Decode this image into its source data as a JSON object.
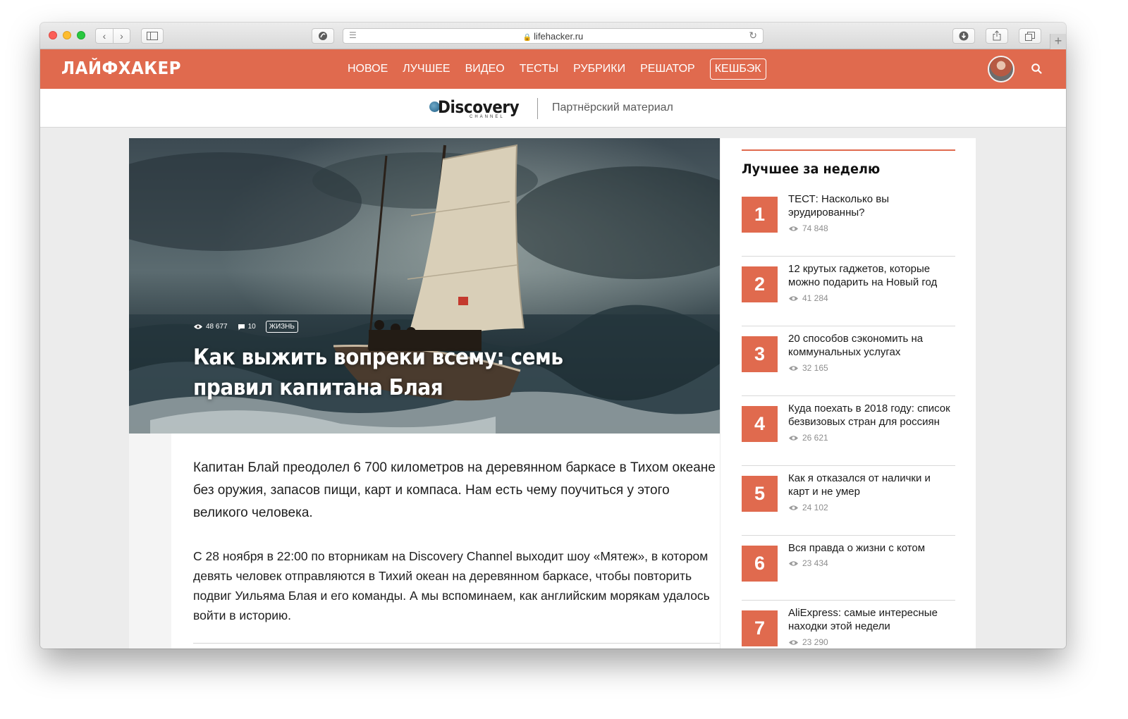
{
  "browser": {
    "url": "lifehacker.ru"
  },
  "site": {
    "logo": "ЛАЙФХАКЕР",
    "nav": [
      "НОВОЕ",
      "ЛУЧШЕЕ",
      "ВИДЕО",
      "ТЕСТЫ",
      "РУБРИКИ",
      "РЕШАТОР"
    ],
    "cashback": "КЕШБЭК",
    "accent_color": "#e06a4e"
  },
  "partner": {
    "brand": "Discovery",
    "brand_sub": "CHANNEL",
    "label": "Партнёрский материал"
  },
  "article": {
    "views": "48 677",
    "comments": "10",
    "tag": "ЖИЗНЬ",
    "title": "Как выжить вопреки всему: семь правил капитана Блая",
    "lead": "Капитан Блай преодолел 6 700 километров на деревянном баркасе в Тихом океане без оружия, запасов пищи, карт и компаса. Нам есть чему поучиться у этого великого человека.",
    "paragraph": "С 28 ноября в 22:00 по вторникам на Discovery Channel выходит шоу «Мятеж», в котором девять человек отправляются в Тихий океан на деревянном баркасе, чтобы повторить подвиг Уильяма Блая и его команды. А мы вспоминаем, как английским морякам удалось войти в историю."
  },
  "sidebar": {
    "title": "Лучшее за неделю",
    "items": [
      {
        "num": "1",
        "title": "ТЕСТ: Насколько вы эрудированны?",
        "views": "74 848"
      },
      {
        "num": "2",
        "title": "12 крутых гаджетов, которые можно подарить на Новый год",
        "views": "41 284"
      },
      {
        "num": "3",
        "title": "20 способов сэкономить на коммунальных услугах",
        "views": "32 165"
      },
      {
        "num": "4",
        "title": "Куда поехать в 2018 году: список безвизовых стран для россиян",
        "views": "26 621"
      },
      {
        "num": "5",
        "title": "Как я отказался от налички и карт и не умер",
        "views": "24 102"
      },
      {
        "num": "6",
        "title": "Вся правда о жизни с котом",
        "views": "23 434"
      },
      {
        "num": "7",
        "title": "AliExpress: самые интересные находки этой недели",
        "views": "23 290"
      }
    ]
  }
}
